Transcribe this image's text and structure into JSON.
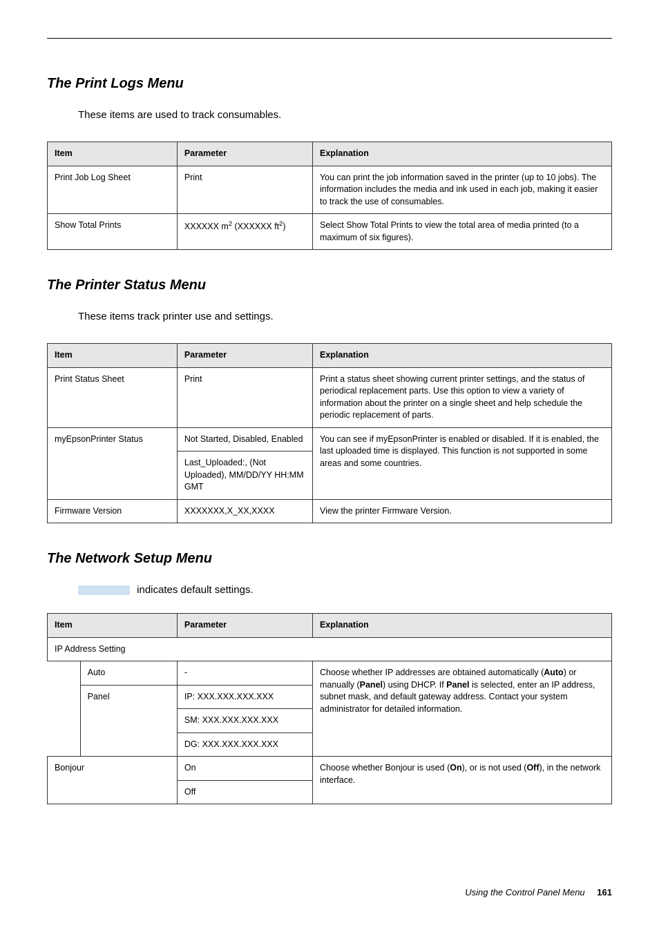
{
  "sections": {
    "printLogs": {
      "title": "The Print Logs Menu",
      "intro": "These items are used to track consumables.",
      "headers": {
        "item": "Item",
        "parameter": "Parameter",
        "explanation": "Explanation"
      },
      "rows": [
        {
          "item": "Print Job Log Sheet",
          "parameter": "Print",
          "explanation": "You can print the job information saved in the printer (up to 10 jobs). The information includes the media and ink used in each job, making it easier to track the use of consumables."
        },
        {
          "item": "Show Total Prints",
          "param_prefix": "XXXXXX m",
          "param_sup1": "2",
          "param_mid": " (XXXXXX ft",
          "param_sup2": "2",
          "param_suffix": ")",
          "explanation": "Select Show Total Prints to view the total area of media printed (to a maximum of six figures)."
        }
      ]
    },
    "printerStatus": {
      "title": "The Printer Status Menu",
      "intro": "These items track printer use and settings.",
      "headers": {
        "item": "Item",
        "parameter": "Parameter",
        "explanation": "Explanation"
      },
      "rows": {
        "printStatusSheet": {
          "item": "Print Status Sheet",
          "parameter": "Print",
          "explanation": "Print a status sheet showing current printer settings, and the status of periodical replacement parts. Use this option to view a variety of information about the printer on a single sheet and help schedule the periodic replacement of parts."
        },
        "myEpson": {
          "item": "myEpsonPrinter Status",
          "param1": "Not Started, Disabled, Enabled",
          "param2": "Last_Uploaded:, (Not Uploaded), MM/DD/YY HH:MM GMT",
          "explanation": "You can see if myEpsonPrinter is enabled or disabled. If it is enabled, the last uploaded time is displayed. This function is not supported in some areas and some countries."
        },
        "firmware": {
          "item": "Firmware Version",
          "parameter": "XXXXXXX,X_XX,XXXX",
          "explanation": "View the printer Firmware Version."
        }
      }
    },
    "networkSetup": {
      "title": "The Network Setup Menu",
      "defaultText": " indicates default settings.",
      "headers": {
        "item": "Item",
        "parameter": "Parameter",
        "explanation": "Explanation"
      },
      "ipAddressSetting": "IP Address Setting",
      "auto": {
        "label": "Auto",
        "param": "-"
      },
      "panel": {
        "label": "Panel",
        "ip": "IP: XXX.XXX.XXX.XXX",
        "sm": "SM: XXX.XXX.XXX.XXX",
        "dg": "DG: XXX.XXX.XXX.XXX"
      },
      "ip_explanation_pre": "Choose whether IP addresses are obtained automatically (",
      "ip_explanation_auto": "Auto",
      "ip_explanation_mid1": ") or manually (",
      "ip_explanation_panel": "Panel",
      "ip_explanation_mid2": ") using DHCP. If ",
      "ip_explanation_panel2": "Panel",
      "ip_explanation_post": " is selected, enter an IP address, subnet mask, and default gateway address. Contact your system administrator for detailed information.",
      "bonjour": {
        "label": "Bonjour",
        "on": "On",
        "off": "Off",
        "exp_pre": "Choose whether Bonjour is used (",
        "exp_on": "On",
        "exp_mid": "), or is not used (",
        "exp_off": "Off",
        "exp_post": "), in the network interface."
      }
    }
  },
  "footer": {
    "text": "Using the Control Panel Menu",
    "page": "161"
  }
}
